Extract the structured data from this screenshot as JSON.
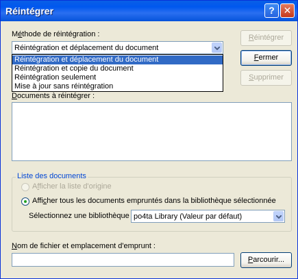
{
  "window": {
    "title": "Réintégrer"
  },
  "titlebar": {
    "help_label": "?",
    "close_label": "✕"
  },
  "method": {
    "label_prefix": "M",
    "label_accel": "é",
    "label_rest": "thode de réintégration :",
    "selected": "Réintégration et déplacement du document",
    "options": [
      "Réintégration et déplacement du document",
      "Réintégration et copie du document",
      "Réintégration seulement",
      "Mise à jour sans réintégration"
    ]
  },
  "buttons": {
    "reintegrate": {
      "accel": "R",
      "rest": "éintégrer"
    },
    "close": {
      "accel": "F",
      "rest": "ermer"
    },
    "delete": {
      "accel": "S",
      "rest": "upprimer"
    },
    "browse": {
      "accel": "P",
      "rest": "arcourir..."
    }
  },
  "documents": {
    "label_accel": "D",
    "label_rest": "ocuments à réintégrer :"
  },
  "doc_list": {
    "group_title": "Liste des documents",
    "radio_origin": {
      "prefix": "A",
      "accel": "f",
      "rest": "ficher la liste d'origine"
    },
    "radio_all": {
      "prefix": "Affi",
      "accel": "c",
      "rest": "her tous les documents empruntés dans la bibliothèque sélectionnée"
    },
    "library_label": "Sélectionnez une bibliothèque :",
    "library_value": "po4ta Library  (Valeur par défaut)"
  },
  "filename": {
    "label_accel": "N",
    "label_rest": "om de fichier et emplacement d'emprunt :",
    "value": ""
  }
}
